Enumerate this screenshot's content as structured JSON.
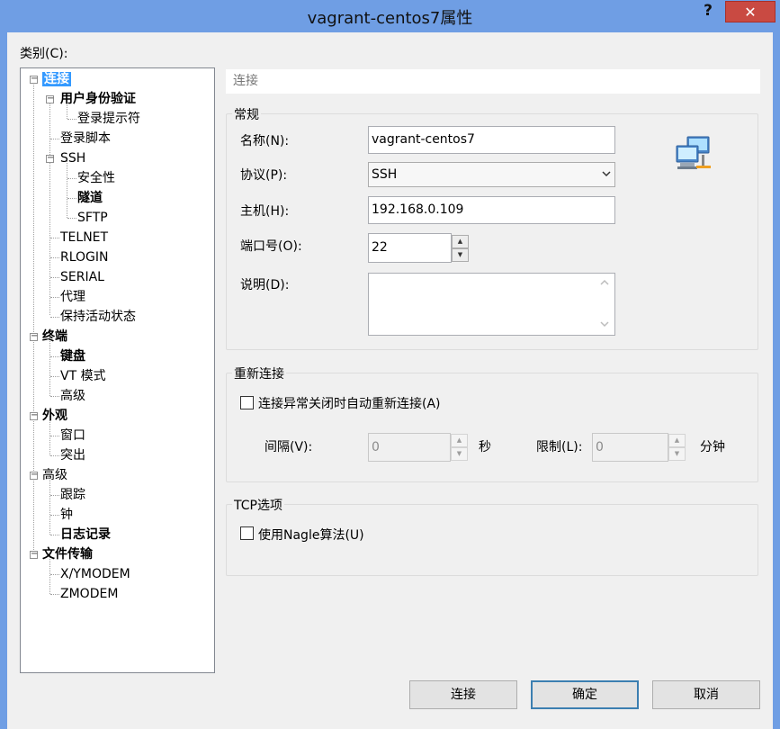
{
  "window": {
    "title": "vagrant-centos7属性",
    "help_label": "?",
    "close_label": "✕"
  },
  "category_label": "类别(C):",
  "tree": {
    "items": [
      {
        "label": "连接"
      },
      {
        "label": "用户身份验证"
      },
      {
        "label": "登录提示符"
      },
      {
        "label": "登录脚本"
      },
      {
        "label": "SSH"
      },
      {
        "label": "安全性"
      },
      {
        "label": "隧道"
      },
      {
        "label": "SFTP"
      },
      {
        "label": "TELNET"
      },
      {
        "label": "RLOGIN"
      },
      {
        "label": "SERIAL"
      },
      {
        "label": "代理"
      },
      {
        "label": "保持活动状态"
      },
      {
        "label": "终端"
      },
      {
        "label": "键盘"
      },
      {
        "label": "VT 模式"
      },
      {
        "label": "高级"
      },
      {
        "label": "外观"
      },
      {
        "label": "窗口"
      },
      {
        "label": "突出"
      },
      {
        "label": "高级"
      },
      {
        "label": "跟踪"
      },
      {
        "label": "钟"
      },
      {
        "label": "日志记录"
      },
      {
        "label": "文件传输"
      },
      {
        "label": "X/YMODEM"
      },
      {
        "label": "ZMODEM"
      }
    ],
    "expand_symbol": "−"
  },
  "section_header": "连接",
  "general": {
    "title": "常规",
    "name_label": "名称(N):",
    "name_value": "vagrant-centos7",
    "protocol_label": "协议(P):",
    "protocol_value": "SSH",
    "host_label": "主机(H):",
    "host_value": "192.168.0.109",
    "port_label": "端口号(O):",
    "port_value": "22",
    "desc_label": "说明(D):",
    "desc_value": ""
  },
  "reconnect": {
    "title": "重新连接",
    "auto_label": "连接异常关闭时自动重新连接(A)",
    "auto_checked": false,
    "interval_label": "间隔(V):",
    "interval_value": "0",
    "interval_unit": "秒",
    "limit_label": "限制(L):",
    "limit_value": "0",
    "limit_unit": "分钟"
  },
  "tcp": {
    "title": "TCP选项",
    "nagle_label": "使用Nagle算法(U)",
    "nagle_checked": false
  },
  "buttons": {
    "connect": "连接",
    "ok": "确定",
    "cancel": "取消"
  },
  "spinner": {
    "up": "▲",
    "down": "▼"
  },
  "colors": {
    "titlebar": "#6f9ee4",
    "close": "#c94a42",
    "selection": "#3399ff",
    "default_button_border": "#3c7fb1"
  }
}
